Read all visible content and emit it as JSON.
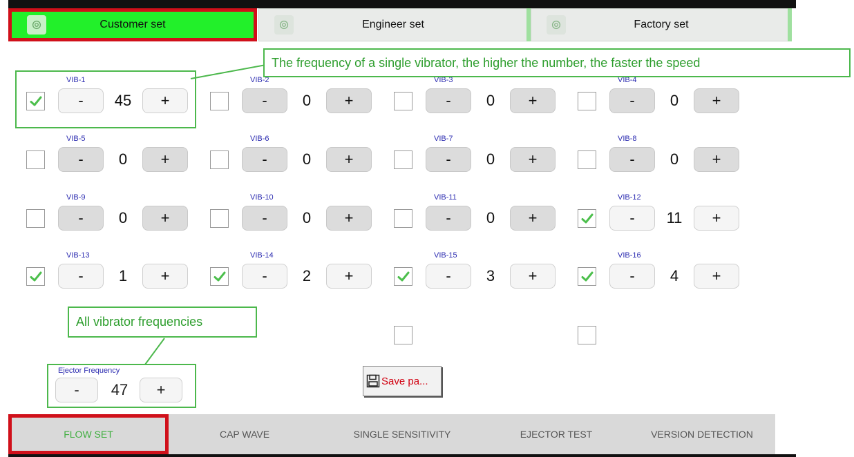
{
  "tabs": [
    {
      "label": "Customer set",
      "icon": "gear-icon",
      "active": true
    },
    {
      "label": "Engineer set",
      "icon": "gear-icon",
      "active": false
    },
    {
      "label": "Factory set",
      "icon": "gear-icon",
      "active": false
    }
  ],
  "vibrators": [
    {
      "label": "VIB-1",
      "value": "45",
      "checked": true
    },
    {
      "label": "VIB-2",
      "value": "0",
      "checked": false
    },
    {
      "label": "VIB-3",
      "value": "0",
      "checked": false
    },
    {
      "label": "VIB-4",
      "value": "0",
      "checked": false
    },
    {
      "label": "VIB-5",
      "value": "0",
      "checked": false
    },
    {
      "label": "VIB-6",
      "value": "0",
      "checked": false
    },
    {
      "label": "VIB-7",
      "value": "0",
      "checked": false
    },
    {
      "label": "VIB-8",
      "value": "0",
      "checked": false
    },
    {
      "label": "VIB-9",
      "value": "0",
      "checked": false
    },
    {
      "label": "VIB-10",
      "value": "0",
      "checked": false
    },
    {
      "label": "VIB-11",
      "value": "0",
      "checked": false
    },
    {
      "label": "VIB-12",
      "value": "11",
      "checked": true
    },
    {
      "label": "VIB-13",
      "value": "1",
      "checked": true
    },
    {
      "label": "VIB-14",
      "value": "2",
      "checked": true
    },
    {
      "label": "VIB-15",
      "value": "3",
      "checked": true
    },
    {
      "label": "VIB-16",
      "value": "4",
      "checked": true
    }
  ],
  "stepper": {
    "minus_label": "-",
    "plus_label": "+"
  },
  "ejector": {
    "label": "Ejector Frequency",
    "value": "47",
    "minus_label": "-",
    "plus_label": "+"
  },
  "save_button": {
    "label": "Save pa...",
    "icon": "floppy-disk-icon"
  },
  "annotations": {
    "single": "The frequency of a single vibrator, the higher the number, the faster the speed",
    "all": "All vibrator frequencies"
  },
  "bottom_nav": [
    {
      "label": "FLOW SET",
      "active": true
    },
    {
      "label": "CAP WAVE",
      "active": false
    },
    {
      "label": "SINGLE SENSITIVITY",
      "active": false
    },
    {
      "label": "EJECTOR TEST",
      "active": false
    },
    {
      "label": "VERSION DETECTION",
      "active": false
    }
  ],
  "colors": {
    "active_tab": "#22f02a",
    "highlight_border": "#d0101a",
    "annotation": "#4cb84c",
    "vib_label": "#2b2bb0",
    "save_text": "#d10010",
    "nav_active": "#3fae3f"
  }
}
